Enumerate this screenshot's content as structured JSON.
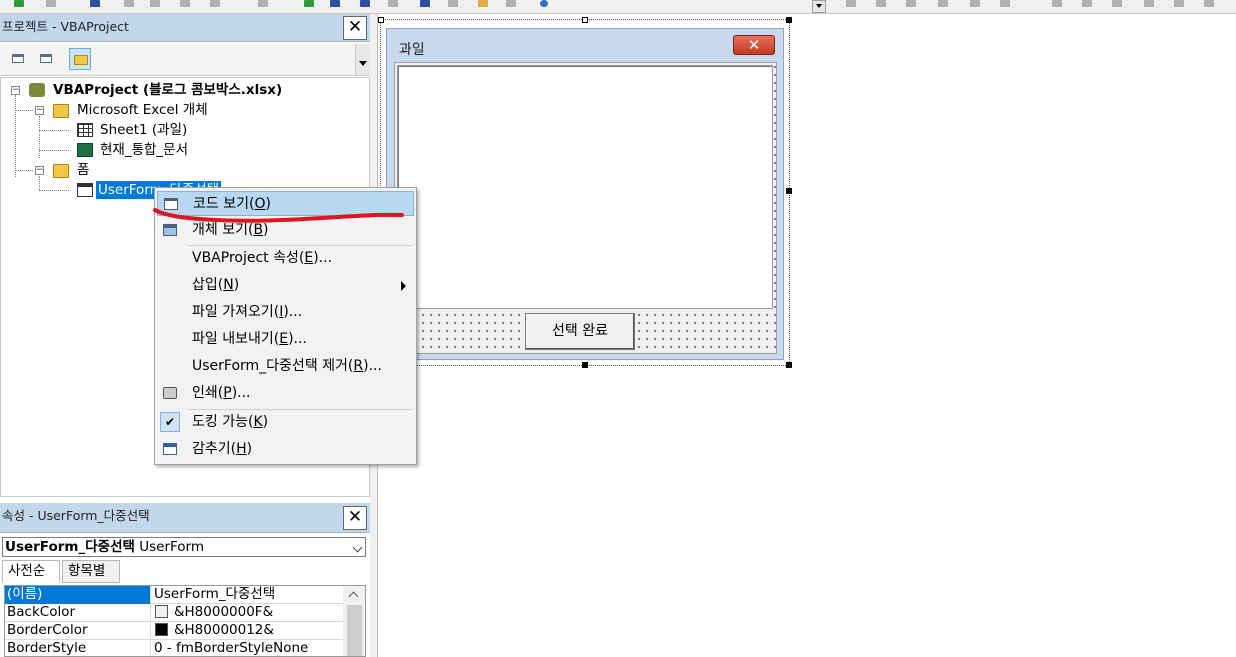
{
  "project_panel": {
    "title": "프로젝트 - VBAProject",
    "close_glyph": "✕",
    "tree": {
      "root": "VBAProject (블로그 콤보박스.xlsx)",
      "excel_objects_folder": "Microsoft Excel 개체",
      "sheet1": "Sheet1 (과일)",
      "workbook": "현재_통합_문서",
      "forms_folder": "폼",
      "userform": "UserForm_다중선택"
    }
  },
  "properties_panel": {
    "title": "속성 - UserForm_다중선택",
    "close_glyph": "✕",
    "object_name": "UserForm_다중선택",
    "object_type": "UserForm",
    "tabs": [
      "사전순",
      "항목별"
    ],
    "rows": [
      {
        "name": "(이름)",
        "value": "UserForm_다중선택"
      },
      {
        "name": "BackColor",
        "value": "&H8000000F&",
        "swatch": "#f0f0f0"
      },
      {
        "name": "BorderColor",
        "value": "&H80000012&",
        "swatch": "#000000"
      },
      {
        "name": "BorderStyle",
        "value": "0 - fmBorderStyleNone"
      }
    ]
  },
  "designer": {
    "form_caption": "과일",
    "close_glyph": "✕",
    "button_label": "선택 완료"
  },
  "context_menu": {
    "items": [
      {
        "pre": "코드 보기(",
        "key": "O",
        "post": ")"
      },
      {
        "pre": "개체 보기(",
        "key": "B",
        "post": ")"
      },
      {
        "pre": "VBAProject 속성(",
        "key": "E",
        "post": ")..."
      },
      {
        "pre": "삽입(",
        "key": "N",
        "post": ")"
      },
      {
        "pre": "파일 가져오기(",
        "key": "I",
        "post": ")..."
      },
      {
        "pre": "파일 내보내기(",
        "key": "E",
        "post": ")..."
      },
      {
        "pre": "UserForm_다중선택 제거(",
        "key": "R",
        "post": ")..."
      },
      {
        "pre": "인쇄(",
        "key": "P",
        "post": ")..."
      },
      {
        "pre": "도킹 가능(",
        "key": "K",
        "post": ")"
      },
      {
        "pre": "감추기(",
        "key": "H",
        "post": ")"
      }
    ],
    "check_glyph": "✔"
  },
  "colors": {
    "panel_title_bg": "#c2d7ec",
    "selection": "#0078d7",
    "menu_highlight": "#b8d8f2",
    "annotation_red": "#e0141e"
  }
}
